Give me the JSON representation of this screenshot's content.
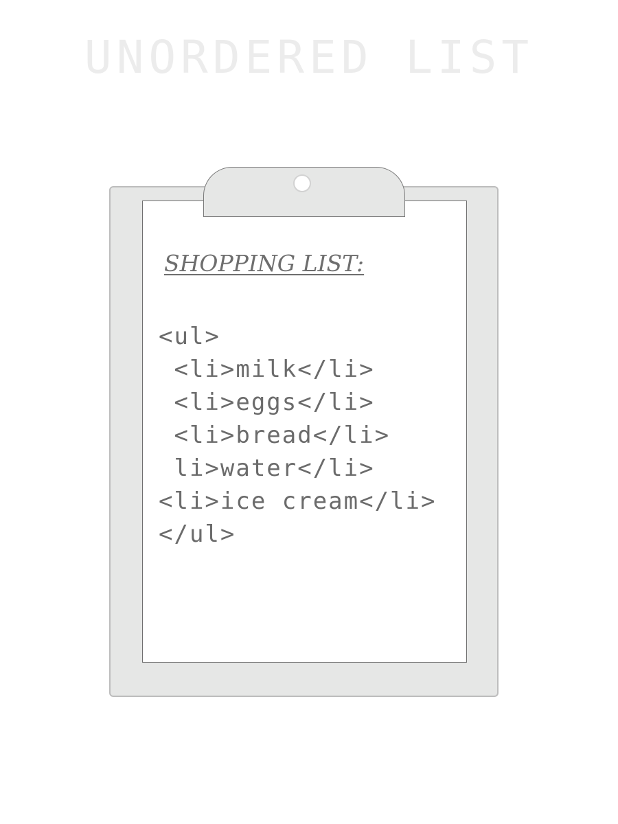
{
  "page": {
    "heading": "UNORDERED LIST"
  },
  "clipboard": {
    "title": "SHOPPING LIST:",
    "code_lines": [
      "<ul>",
      " <li>milk</li>",
      " <li>eggs</li>",
      " <li>bread</li>",
      " li>water</li>",
      "<li>ice cream</li>",
      "</ul>"
    ]
  },
  "colors": {
    "heading": "#ececec",
    "board": "#e6e7e6",
    "paper": "#ffffff",
    "text": "#6b6b6b"
  },
  "icons": {
    "clip": "clipboard-clip-icon"
  }
}
